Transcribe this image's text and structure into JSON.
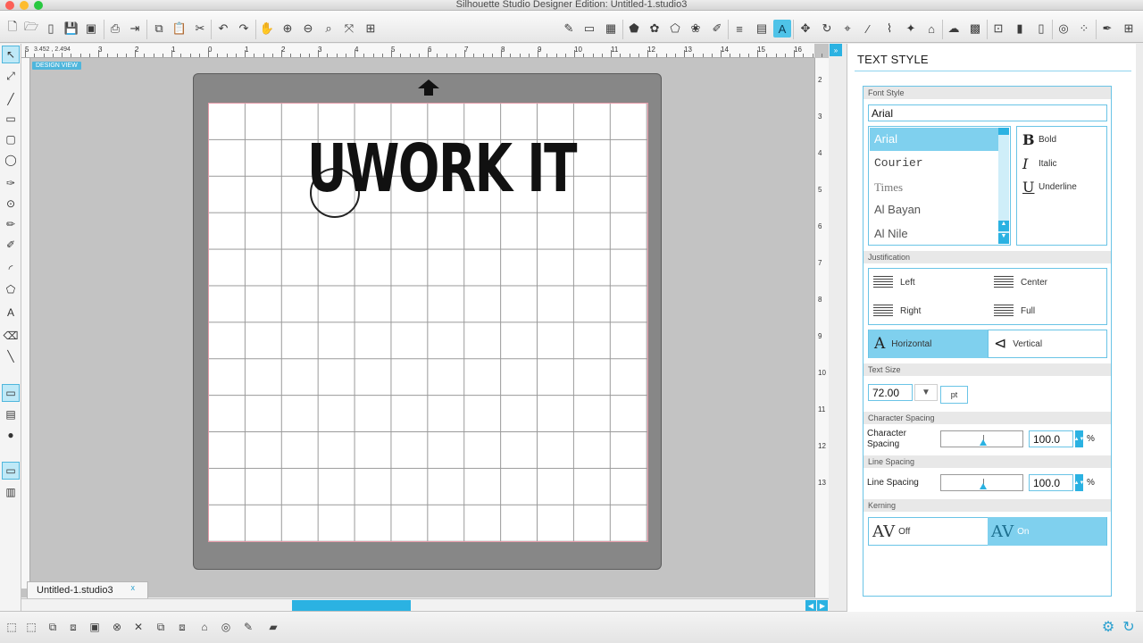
{
  "window": {
    "title": "Silhouette Studio Designer Edition: Untitled-1.studio3"
  },
  "toolbar": {
    "icons": [
      "new-document-icon",
      "open-folder-icon",
      "open-file-icon",
      "save-icon",
      "save-to-library-icon",
      "print-icon",
      "send-to-cutter-icon",
      "copy-icon",
      "paste-icon",
      "cut-icon",
      "undo-icon",
      "redo-icon",
      "pan-hand-icon",
      "zoom-in-icon",
      "zoom-out-icon",
      "zoom-select-icon",
      "drag-zoom-icon",
      "fit-to-page-icon"
    ],
    "right_icons": [
      "draw-tool-icon",
      "page-setup-icon",
      "grid-icon",
      "shape-fill-icon",
      "fill-pattern-icon",
      "gradient-icon",
      "line-style-icon",
      "line-color-icon",
      "text-style-icon",
      "transform-icon",
      "replicate-icon",
      "modify-icon",
      "offset-icon",
      "trace-icon",
      "library-icon",
      "store-icon",
      "rhinestone-icon",
      "sketch-icon",
      "cut-settings-icon",
      "send-icon"
    ]
  },
  "canvas": {
    "coords": "3.452 , 2.494",
    "design_view_label": "DESIGN VIEW",
    "ruler_top": [
      "5",
      "4",
      "3",
      "2",
      "1",
      "0",
      "1",
      "2",
      "3",
      "4",
      "5",
      "6",
      "7",
      "8",
      "9",
      "10",
      "11",
      "12",
      "13",
      "14",
      "15",
      "16"
    ],
    "ruler_right": [
      "2",
      "3",
      "4",
      "5",
      "6",
      "7",
      "8",
      "9",
      "10",
      "11",
      "12",
      "13"
    ],
    "design_text": "UWORK IT"
  },
  "document_tab": {
    "label": "Untitled-1.studio3",
    "close": "x"
  },
  "panel": {
    "title": "TEXT STYLE",
    "font_style": {
      "header": "Font Style",
      "current": "Arial",
      "fonts": [
        "Arial",
        "Courier",
        "Times",
        "Al Bayan",
        "Al Nile"
      ],
      "styles": [
        {
          "glyph": "B",
          "label": "Bold"
        },
        {
          "glyph": "I",
          "label": "Italic"
        },
        {
          "glyph": "U",
          "label": "Underline"
        }
      ]
    },
    "justification": {
      "header": "Justification",
      "options": [
        "Left",
        "Center",
        "Right",
        "Full"
      ],
      "direction": [
        "Horizontal",
        "Vertical"
      ]
    },
    "text_size": {
      "header": "Text Size",
      "value": "72.00",
      "unit": "pt"
    },
    "character_spacing": {
      "header": "Character Spacing",
      "label": "Character Spacing",
      "value": "100.0",
      "unit": "%"
    },
    "line_spacing": {
      "header": "Line Spacing",
      "label": "Line Spacing",
      "value": "100.0",
      "unit": "%"
    },
    "kerning": {
      "header": "Kerning",
      "off": "Off",
      "on": "On",
      "glyph": "AV"
    }
  },
  "colors": {
    "accent": "#2bb2e2",
    "selection": "#7fd0ee",
    "mat": "#878787"
  }
}
